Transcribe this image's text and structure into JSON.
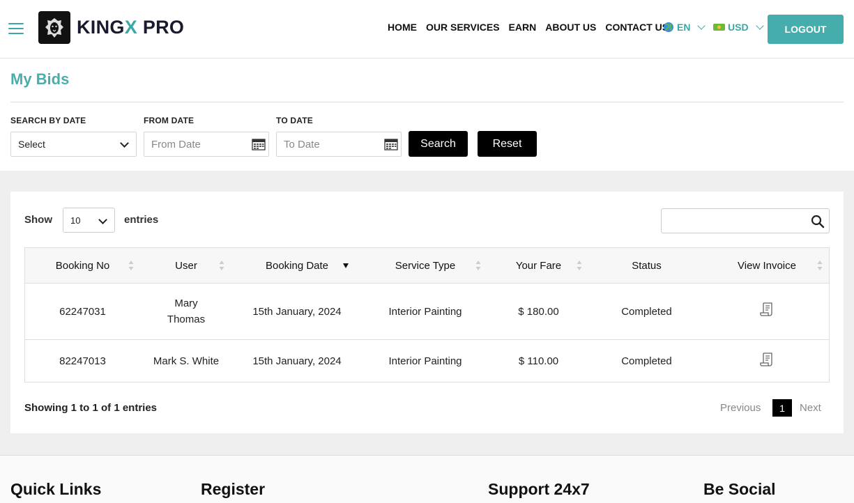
{
  "brand": {
    "name_prefix": "KING",
    "name_x": "X",
    "name_suffix": " PRO",
    "accent": "#45aeac"
  },
  "nav": {
    "items": [
      "HOME",
      "OUR SERVICES",
      "EARN",
      "ABOUT US",
      "CONTACT US"
    ]
  },
  "language": {
    "label": "EN"
  },
  "currency": {
    "label": "USD"
  },
  "logout_label": "LOGOUT",
  "page": {
    "title": "My Bids"
  },
  "filters": {
    "search_by_date_label": "SEARCH BY DATE",
    "search_by_date_value": "Select",
    "from_label": "FROM DATE",
    "from_placeholder": "From Date",
    "to_label": "TO DATE",
    "to_placeholder": "To Date",
    "search_button": "Search",
    "reset_button": "Reset"
  },
  "table_controls": {
    "show_label": "Show",
    "page_size": "10",
    "entries_label": "entries"
  },
  "table": {
    "columns": [
      "Booking No",
      "User",
      "Booking Date",
      "Service Type",
      "Your Fare",
      "Status",
      "View Invoice"
    ],
    "rows": [
      {
        "booking_no": "62247031",
        "user_line1": "Mary",
        "user_line2": "Thomas",
        "date": "15th January, 2024",
        "service": "Interior Painting",
        "fare": "$ 180.00",
        "status": "Completed"
      },
      {
        "booking_no": "82247013",
        "user": "Mark S. White",
        "date": "15th January, 2024",
        "service": "Interior Painting",
        "fare": "$ 110.00",
        "status": "Completed"
      }
    ]
  },
  "pagination": {
    "summary": "Showing 1 to 1 of 1 entries",
    "previous": "Previous",
    "current": "1",
    "next": "Next"
  },
  "footer": {
    "headings": [
      "Quick Links",
      "Register",
      "Support 24x7",
      "Be Social"
    ]
  }
}
